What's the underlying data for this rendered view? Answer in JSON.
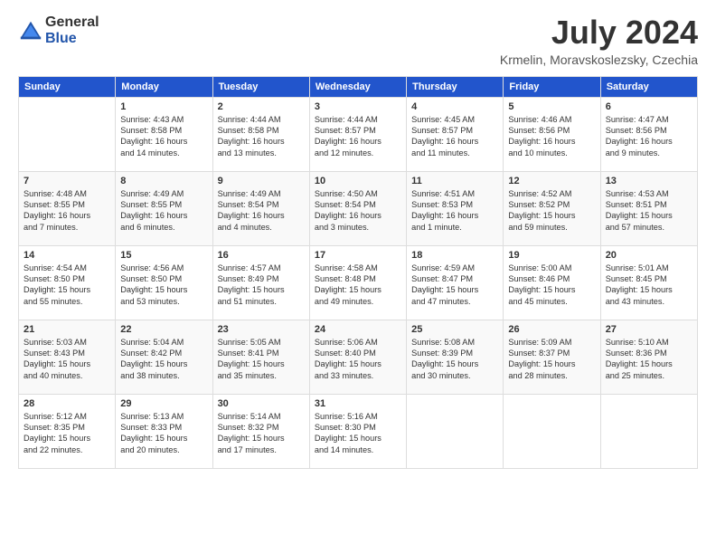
{
  "header": {
    "logo_general": "General",
    "logo_blue": "Blue",
    "month_year": "July 2024",
    "location": "Krmelin, Moravskoslezsky, Czechia"
  },
  "days_of_week": [
    "Sunday",
    "Monday",
    "Tuesday",
    "Wednesday",
    "Thursday",
    "Friday",
    "Saturday"
  ],
  "weeks": [
    [
      {
        "day": "",
        "info": ""
      },
      {
        "day": "1",
        "info": "Sunrise: 4:43 AM\nSunset: 8:58 PM\nDaylight: 16 hours\nand 14 minutes."
      },
      {
        "day": "2",
        "info": "Sunrise: 4:44 AM\nSunset: 8:58 PM\nDaylight: 16 hours\nand 13 minutes."
      },
      {
        "day": "3",
        "info": "Sunrise: 4:44 AM\nSunset: 8:57 PM\nDaylight: 16 hours\nand 12 minutes."
      },
      {
        "day": "4",
        "info": "Sunrise: 4:45 AM\nSunset: 8:57 PM\nDaylight: 16 hours\nand 11 minutes."
      },
      {
        "day": "5",
        "info": "Sunrise: 4:46 AM\nSunset: 8:56 PM\nDaylight: 16 hours\nand 10 minutes."
      },
      {
        "day": "6",
        "info": "Sunrise: 4:47 AM\nSunset: 8:56 PM\nDaylight: 16 hours\nand 9 minutes."
      }
    ],
    [
      {
        "day": "7",
        "info": "Sunrise: 4:48 AM\nSunset: 8:55 PM\nDaylight: 16 hours\nand 7 minutes."
      },
      {
        "day": "8",
        "info": "Sunrise: 4:49 AM\nSunset: 8:55 PM\nDaylight: 16 hours\nand 6 minutes."
      },
      {
        "day": "9",
        "info": "Sunrise: 4:49 AM\nSunset: 8:54 PM\nDaylight: 16 hours\nand 4 minutes."
      },
      {
        "day": "10",
        "info": "Sunrise: 4:50 AM\nSunset: 8:54 PM\nDaylight: 16 hours\nand 3 minutes."
      },
      {
        "day": "11",
        "info": "Sunrise: 4:51 AM\nSunset: 8:53 PM\nDaylight: 16 hours\nand 1 minute."
      },
      {
        "day": "12",
        "info": "Sunrise: 4:52 AM\nSunset: 8:52 PM\nDaylight: 15 hours\nand 59 minutes."
      },
      {
        "day": "13",
        "info": "Sunrise: 4:53 AM\nSunset: 8:51 PM\nDaylight: 15 hours\nand 57 minutes."
      }
    ],
    [
      {
        "day": "14",
        "info": "Sunrise: 4:54 AM\nSunset: 8:50 PM\nDaylight: 15 hours\nand 55 minutes."
      },
      {
        "day": "15",
        "info": "Sunrise: 4:56 AM\nSunset: 8:50 PM\nDaylight: 15 hours\nand 53 minutes."
      },
      {
        "day": "16",
        "info": "Sunrise: 4:57 AM\nSunset: 8:49 PM\nDaylight: 15 hours\nand 51 minutes."
      },
      {
        "day": "17",
        "info": "Sunrise: 4:58 AM\nSunset: 8:48 PM\nDaylight: 15 hours\nand 49 minutes."
      },
      {
        "day": "18",
        "info": "Sunrise: 4:59 AM\nSunset: 8:47 PM\nDaylight: 15 hours\nand 47 minutes."
      },
      {
        "day": "19",
        "info": "Sunrise: 5:00 AM\nSunset: 8:46 PM\nDaylight: 15 hours\nand 45 minutes."
      },
      {
        "day": "20",
        "info": "Sunrise: 5:01 AM\nSunset: 8:45 PM\nDaylight: 15 hours\nand 43 minutes."
      }
    ],
    [
      {
        "day": "21",
        "info": "Sunrise: 5:03 AM\nSunset: 8:43 PM\nDaylight: 15 hours\nand 40 minutes."
      },
      {
        "day": "22",
        "info": "Sunrise: 5:04 AM\nSunset: 8:42 PM\nDaylight: 15 hours\nand 38 minutes."
      },
      {
        "day": "23",
        "info": "Sunrise: 5:05 AM\nSunset: 8:41 PM\nDaylight: 15 hours\nand 35 minutes."
      },
      {
        "day": "24",
        "info": "Sunrise: 5:06 AM\nSunset: 8:40 PM\nDaylight: 15 hours\nand 33 minutes."
      },
      {
        "day": "25",
        "info": "Sunrise: 5:08 AM\nSunset: 8:39 PM\nDaylight: 15 hours\nand 30 minutes."
      },
      {
        "day": "26",
        "info": "Sunrise: 5:09 AM\nSunset: 8:37 PM\nDaylight: 15 hours\nand 28 minutes."
      },
      {
        "day": "27",
        "info": "Sunrise: 5:10 AM\nSunset: 8:36 PM\nDaylight: 15 hours\nand 25 minutes."
      }
    ],
    [
      {
        "day": "28",
        "info": "Sunrise: 5:12 AM\nSunset: 8:35 PM\nDaylight: 15 hours\nand 22 minutes."
      },
      {
        "day": "29",
        "info": "Sunrise: 5:13 AM\nSunset: 8:33 PM\nDaylight: 15 hours\nand 20 minutes."
      },
      {
        "day": "30",
        "info": "Sunrise: 5:14 AM\nSunset: 8:32 PM\nDaylight: 15 hours\nand 17 minutes."
      },
      {
        "day": "31",
        "info": "Sunrise: 5:16 AM\nSunset: 8:30 PM\nDaylight: 15 hours\nand 14 minutes."
      },
      {
        "day": "",
        "info": ""
      },
      {
        "day": "",
        "info": ""
      },
      {
        "day": "",
        "info": ""
      }
    ]
  ]
}
